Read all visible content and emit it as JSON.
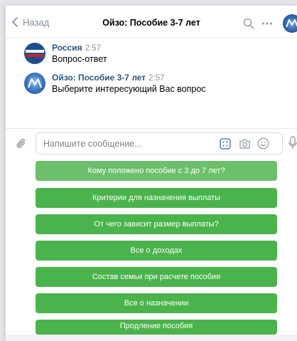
{
  "header": {
    "back_label": "Назад",
    "title": "Ойзо: Пособие 3-7 лет"
  },
  "messages": [
    {
      "author": "Россия",
      "time": "2:57",
      "text": "Вопрос-ответ"
    },
    {
      "author": "Ойзо: Пособие 3-7 лет",
      "time": "2:57",
      "text": "Выберите интересующий Вас вопрос"
    }
  ],
  "composer": {
    "placeholder": "Напишите сообщение..."
  },
  "keyboard": {
    "buttons": [
      "Кому положено пособие с 3 до 7 лет?",
      "Критерии для назначения выплаты",
      "От чего зависит размер выплаты?",
      "Все о доходах",
      "Состав семьи при расчете пособия",
      "Все о назначении",
      "Продление пособия"
    ]
  },
  "colors": {
    "button_green": "#4bb34b",
    "link_blue": "#2a5885"
  }
}
